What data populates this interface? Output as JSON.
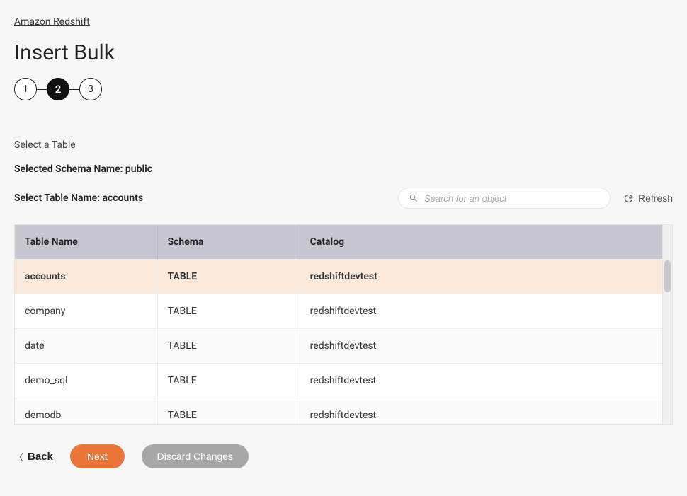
{
  "breadcrumb": {
    "link_text": "Amazon Redshift"
  },
  "page_title": "Insert Bulk",
  "stepper": {
    "step1": "1",
    "step2": "2",
    "step3": "3",
    "active": 2
  },
  "section_label": "Select a Table",
  "schema_line_label": "Selected Schema Name: ",
  "schema_line_value": "public",
  "table_line_label": "Select Table Name: ",
  "table_line_value": "accounts",
  "search": {
    "placeholder": "Search for an object"
  },
  "refresh_label": "Refresh",
  "table": {
    "headers": {
      "name": "Table Name",
      "schema": "Schema",
      "catalog": "Catalog"
    },
    "rows": [
      {
        "name": "accounts",
        "schema": "TABLE",
        "catalog": "redshiftdevtest",
        "selected": true
      },
      {
        "name": "company",
        "schema": "TABLE",
        "catalog": "redshiftdevtest"
      },
      {
        "name": "date",
        "schema": "TABLE",
        "catalog": "redshiftdevtest"
      },
      {
        "name": "demo_sql",
        "schema": "TABLE",
        "catalog": "redshiftdevtest"
      },
      {
        "name": "demodb",
        "schema": "TABLE",
        "catalog": "redshiftdevtest"
      }
    ]
  },
  "footer": {
    "back": "Back",
    "next": "Next",
    "discard": "Discard Changes"
  }
}
